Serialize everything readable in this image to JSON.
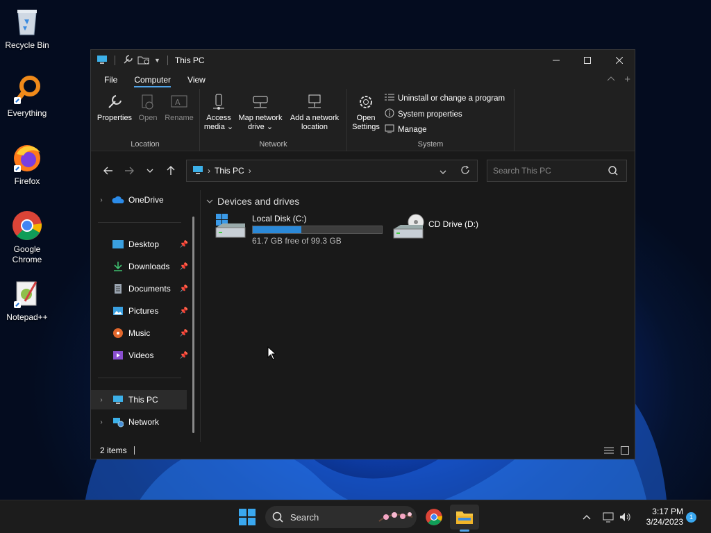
{
  "desktop": {
    "icons": [
      {
        "label": "Recycle Bin"
      },
      {
        "label": "Everything"
      },
      {
        "label": "Firefox"
      },
      {
        "label": "Google Chrome"
      },
      {
        "label": "Notepad++"
      }
    ]
  },
  "window": {
    "title": "This PC",
    "menu_tabs": [
      "File",
      "Computer",
      "View"
    ],
    "active_tab": "Computer",
    "ribbon": {
      "location": {
        "label": "Location",
        "buttons": [
          "Properties",
          "Open",
          "Rename"
        ]
      },
      "network": {
        "label": "Network",
        "access_media": [
          "Access",
          "media ⌄"
        ],
        "map_drive": [
          "Map network",
          "drive ⌄"
        ],
        "add_location": [
          "Add a network",
          "location"
        ]
      },
      "system": {
        "label": "System",
        "open_settings": [
          "Open",
          "Settings"
        ],
        "items": [
          "Uninstall or change a program",
          "System properties",
          "Manage"
        ]
      }
    },
    "address": {
      "path": "This PC",
      "search_placeholder": "Search This PC"
    },
    "nav": {
      "onedrive": "OneDrive",
      "quick": [
        {
          "label": "Desktop"
        },
        {
          "label": "Downloads"
        },
        {
          "label": "Documents"
        },
        {
          "label": "Pictures"
        },
        {
          "label": "Music"
        },
        {
          "label": "Videos"
        }
      ],
      "this_pc": "This PC",
      "network": "Network"
    },
    "content": {
      "section": "Devices and drives",
      "drives": [
        {
          "name": "Local Disk (C:)",
          "detail": "61.7 GB free of 99.3 GB",
          "used_fraction": 0.379
        },
        {
          "name": "CD Drive (D:)"
        }
      ]
    },
    "status": {
      "count": "2 items"
    }
  },
  "taskbar": {
    "search_label": "Search",
    "time": "3:17 PM",
    "date": "3/24/2023",
    "notification_count": "1"
  }
}
